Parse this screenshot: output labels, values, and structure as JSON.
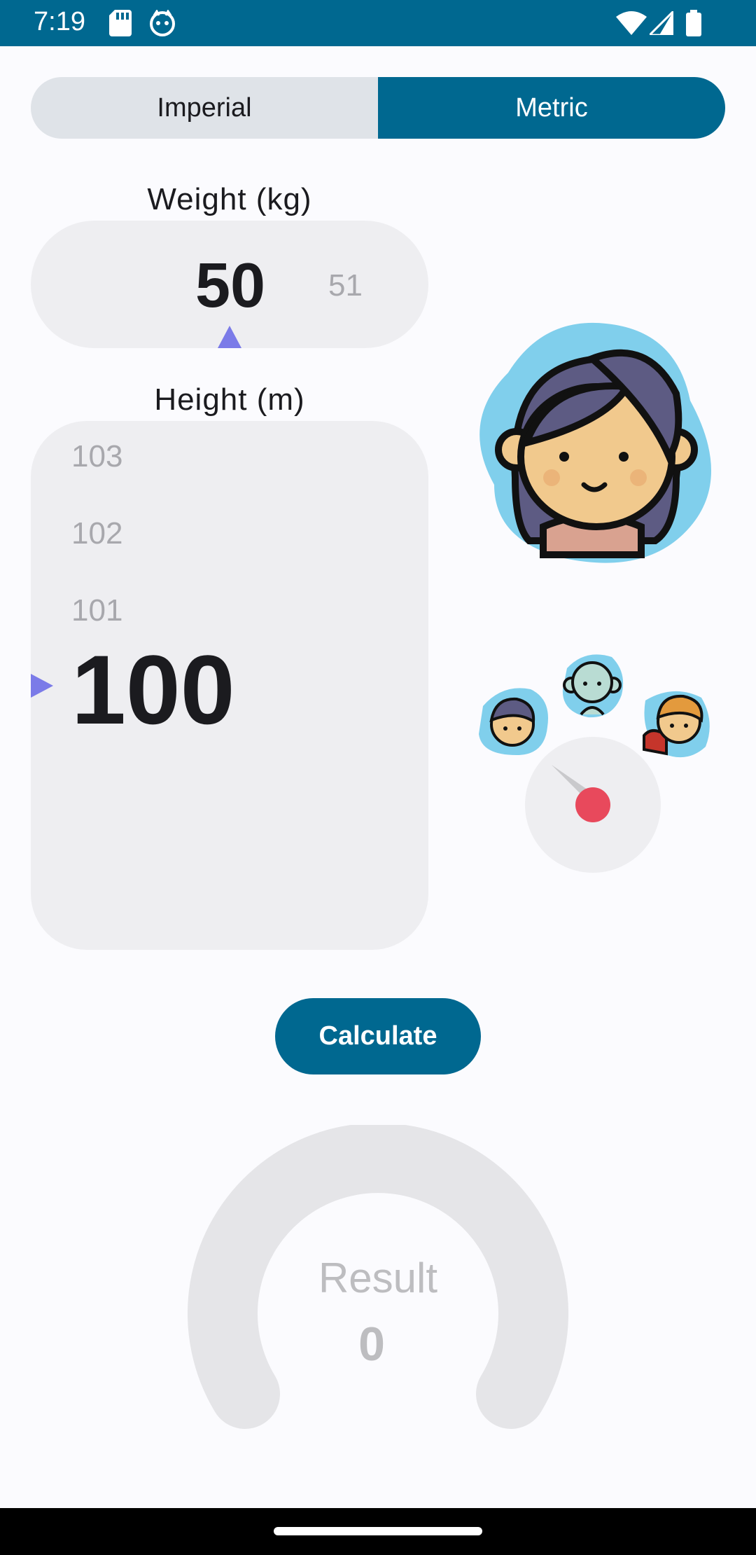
{
  "status_bar": {
    "time": "7:19",
    "left_icons": [
      "sd-card-icon",
      "android-cat-icon"
    ],
    "right_icons": [
      "wifi-icon",
      "signal-icon",
      "battery-icon"
    ],
    "background": "#006890"
  },
  "unit_toggle": {
    "options": [
      "Imperial",
      "Metric"
    ],
    "selected": "Metric",
    "active_color": "#006890",
    "inactive_color": "#dfe3e8"
  },
  "weight": {
    "label": "Weight (kg)",
    "value": "50",
    "next": "51"
  },
  "height": {
    "label": "Height (m)",
    "above": [
      "103",
      "102",
      "101"
    ],
    "value": "100"
  },
  "illustrations": {
    "main_avatar": "girl-avatar-icon",
    "options": [
      "girl-small-icon",
      "alien-small-icon",
      "boy-small-icon"
    ],
    "selector": "dial-selector-icon"
  },
  "calculate_button": {
    "label": "Calculate"
  },
  "result": {
    "label": "Result",
    "value": "0",
    "progress": 0
  },
  "colors": {
    "indicator": "#7b7be8",
    "dial_dot": "#e8495c",
    "avatar_blob": "#80cfec"
  }
}
